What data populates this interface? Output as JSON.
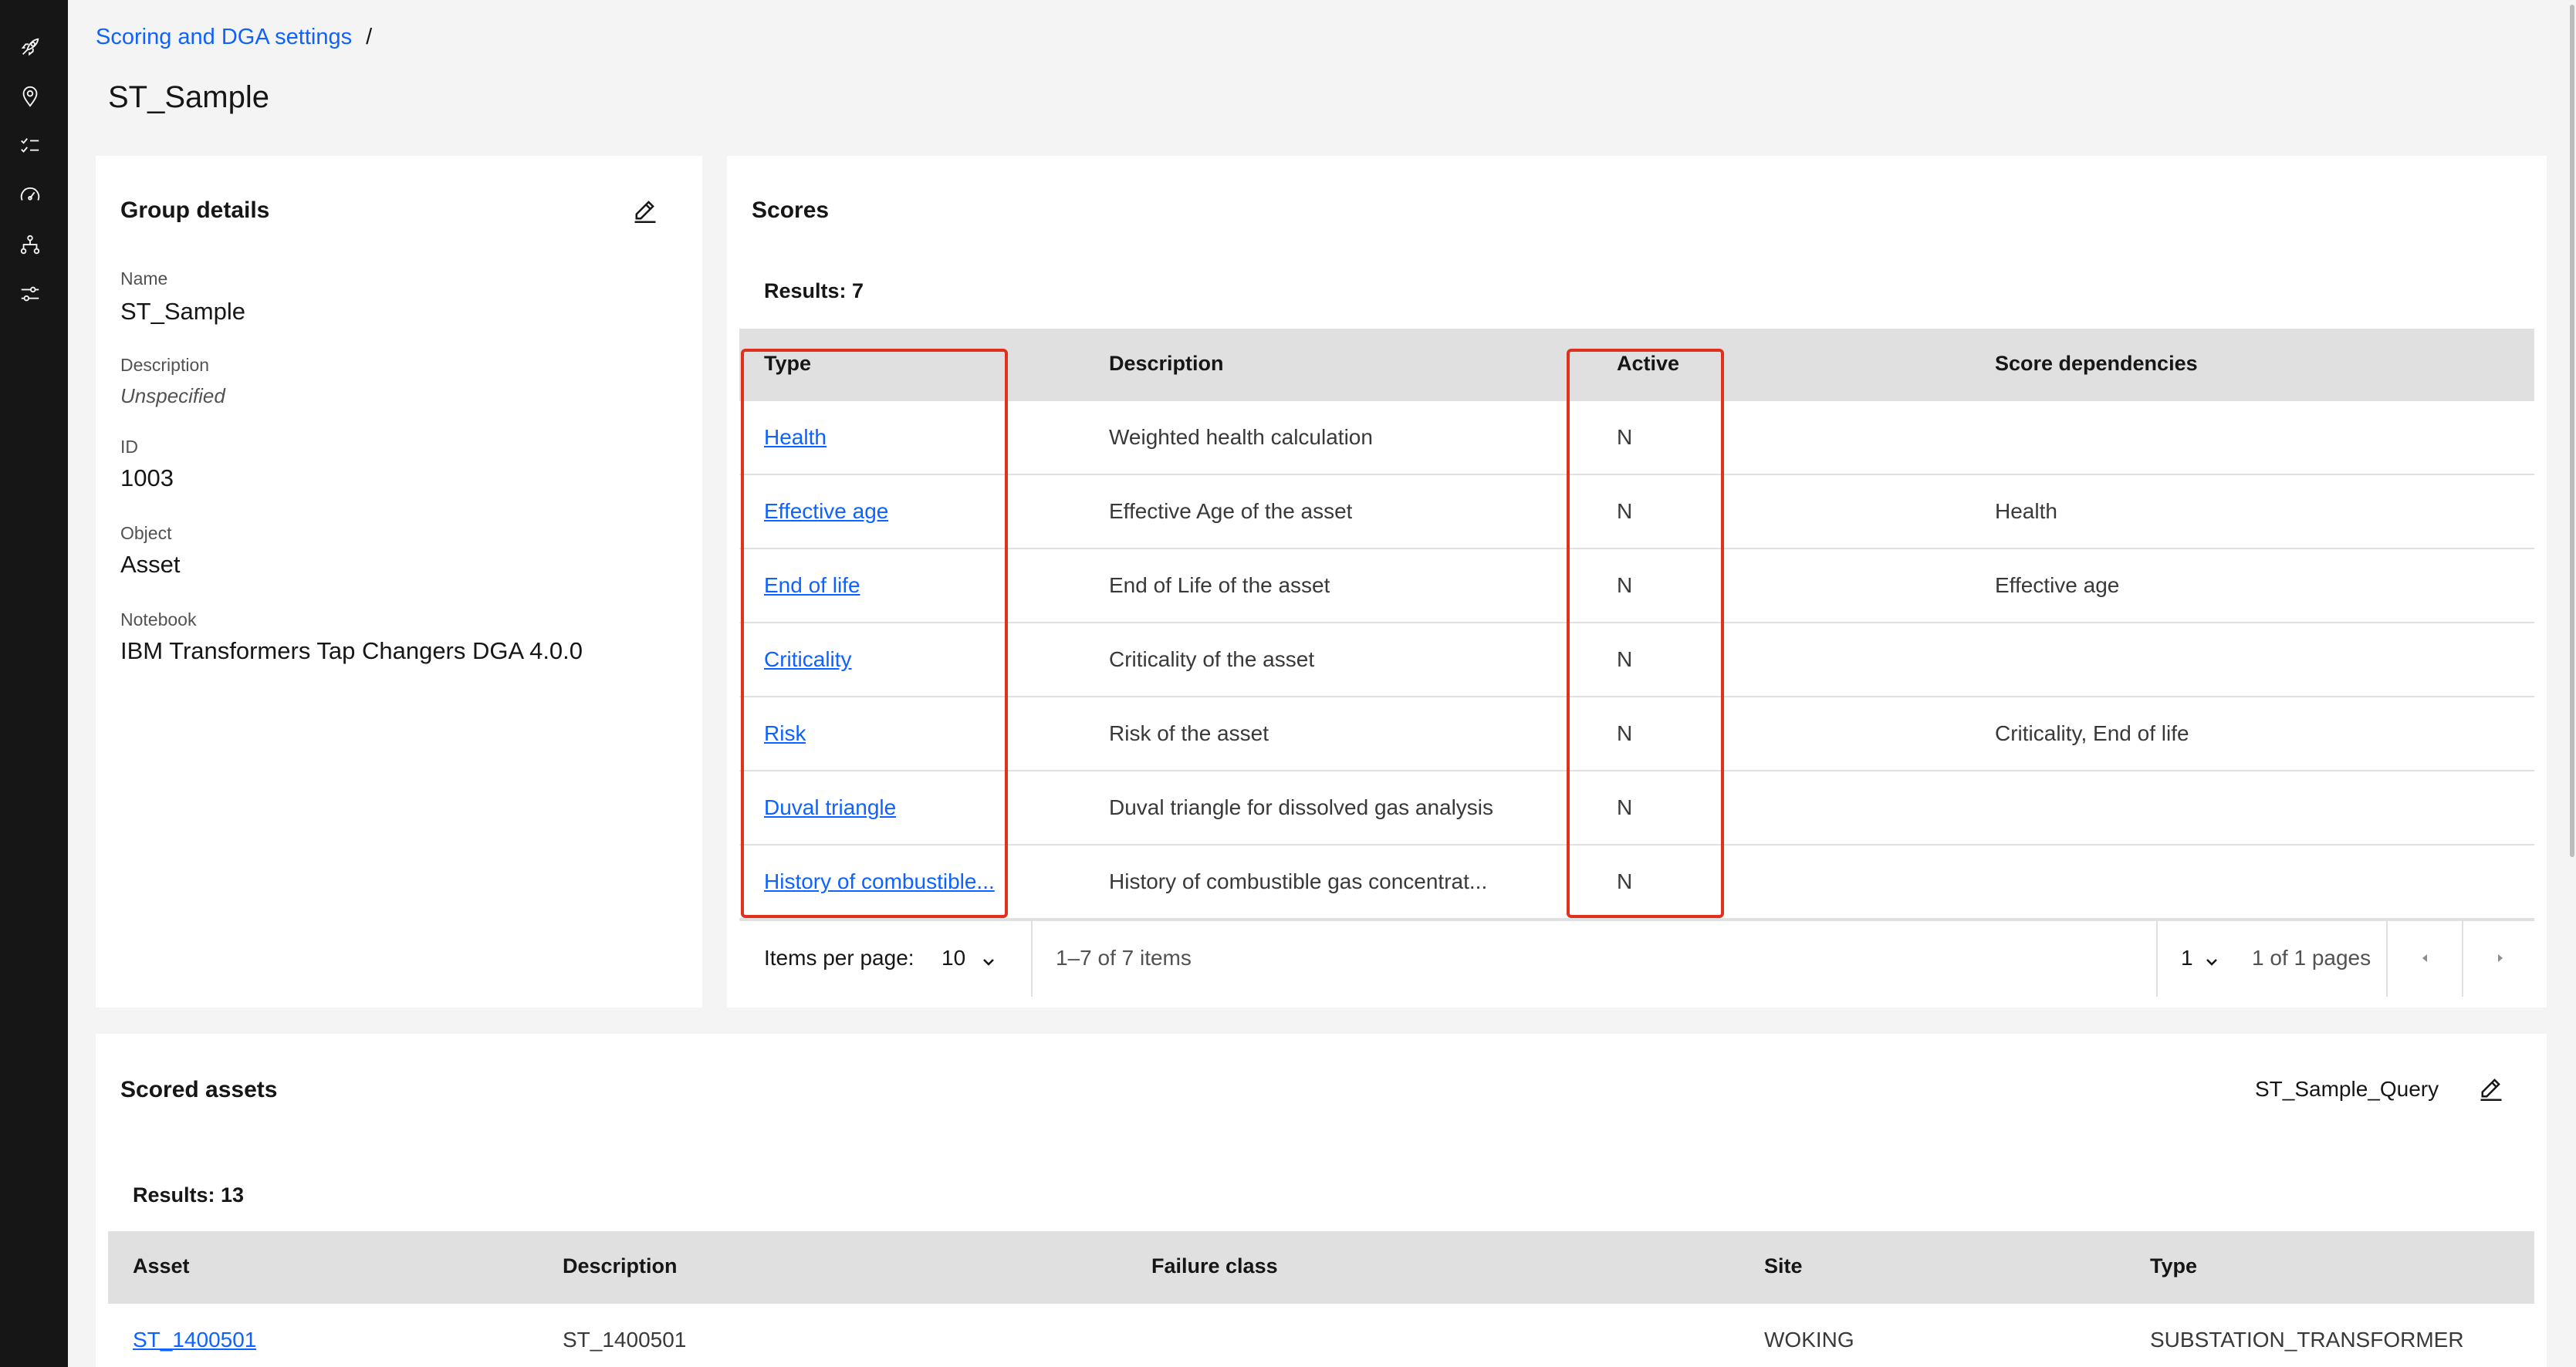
{
  "nav": {
    "icons": [
      "rocket-icon",
      "location-icon",
      "checklist-icon",
      "gauge-icon",
      "hierarchy-icon",
      "settings-sliders-icon"
    ]
  },
  "breadcrumb": {
    "parent": "Scoring and DGA settings",
    "separator": "/"
  },
  "page": {
    "title": "ST_Sample"
  },
  "group_details": {
    "title": "Group details",
    "fields": [
      {
        "label": "Name",
        "value": "ST_Sample"
      },
      {
        "label": "Description",
        "value": "Unspecified"
      },
      {
        "label": "ID",
        "value": "1003"
      },
      {
        "label": "Object",
        "value": "Asset"
      },
      {
        "label": "Notebook",
        "value": "IBM Transformers Tap Changers DGA 4.0.0"
      }
    ]
  },
  "scores": {
    "title": "Scores",
    "results": "Results: 7",
    "columns": [
      "Type",
      "Description",
      "Active",
      "Score dependencies"
    ],
    "rows": [
      {
        "type": "Health",
        "description": "Weighted health calculation",
        "active": "N",
        "deps": ""
      },
      {
        "type": "Effective age",
        "description": "Effective Age of the asset",
        "active": "N",
        "deps": "Health"
      },
      {
        "type": "End of life",
        "description": "End of Life of the asset",
        "active": "N",
        "deps": "Effective age"
      },
      {
        "type": "Criticality",
        "description": "Criticality of the asset",
        "active": "N",
        "deps": ""
      },
      {
        "type": "Risk",
        "description": "Risk of the asset",
        "active": "N",
        "deps": "Criticality, End of life"
      },
      {
        "type": "Duval triangle",
        "description": "Duval triangle for dissolved gas analysis",
        "active": "N",
        "deps": ""
      },
      {
        "type": "History of combustible...",
        "description": "History of combustible gas concentrat...",
        "active": "N",
        "deps": ""
      }
    ],
    "pagination": {
      "items_per_page_label": "Items per page:",
      "items_per_page": "10",
      "range": "1–7 of 7 items",
      "page": "1",
      "pages": "1 of 1 pages"
    },
    "highlight_color": "#e0301e"
  },
  "scored_assets": {
    "title": "Scored assets",
    "query": "ST_Sample_Query",
    "results": "Results: 13",
    "columns": [
      "Asset",
      "Description",
      "Failure class",
      "Site",
      "Type"
    ],
    "rows": [
      {
        "asset": "ST_1400501",
        "description": "ST_1400501",
        "failure_class": "",
        "site": "WOKING",
        "type": "SUBSTATION_TRANSFORMER"
      }
    ]
  },
  "colors": {
    "link": "#0f62fe",
    "rail": "#161616",
    "header_bg": "#e0e0e0",
    "page_bg": "#f4f4f4"
  }
}
